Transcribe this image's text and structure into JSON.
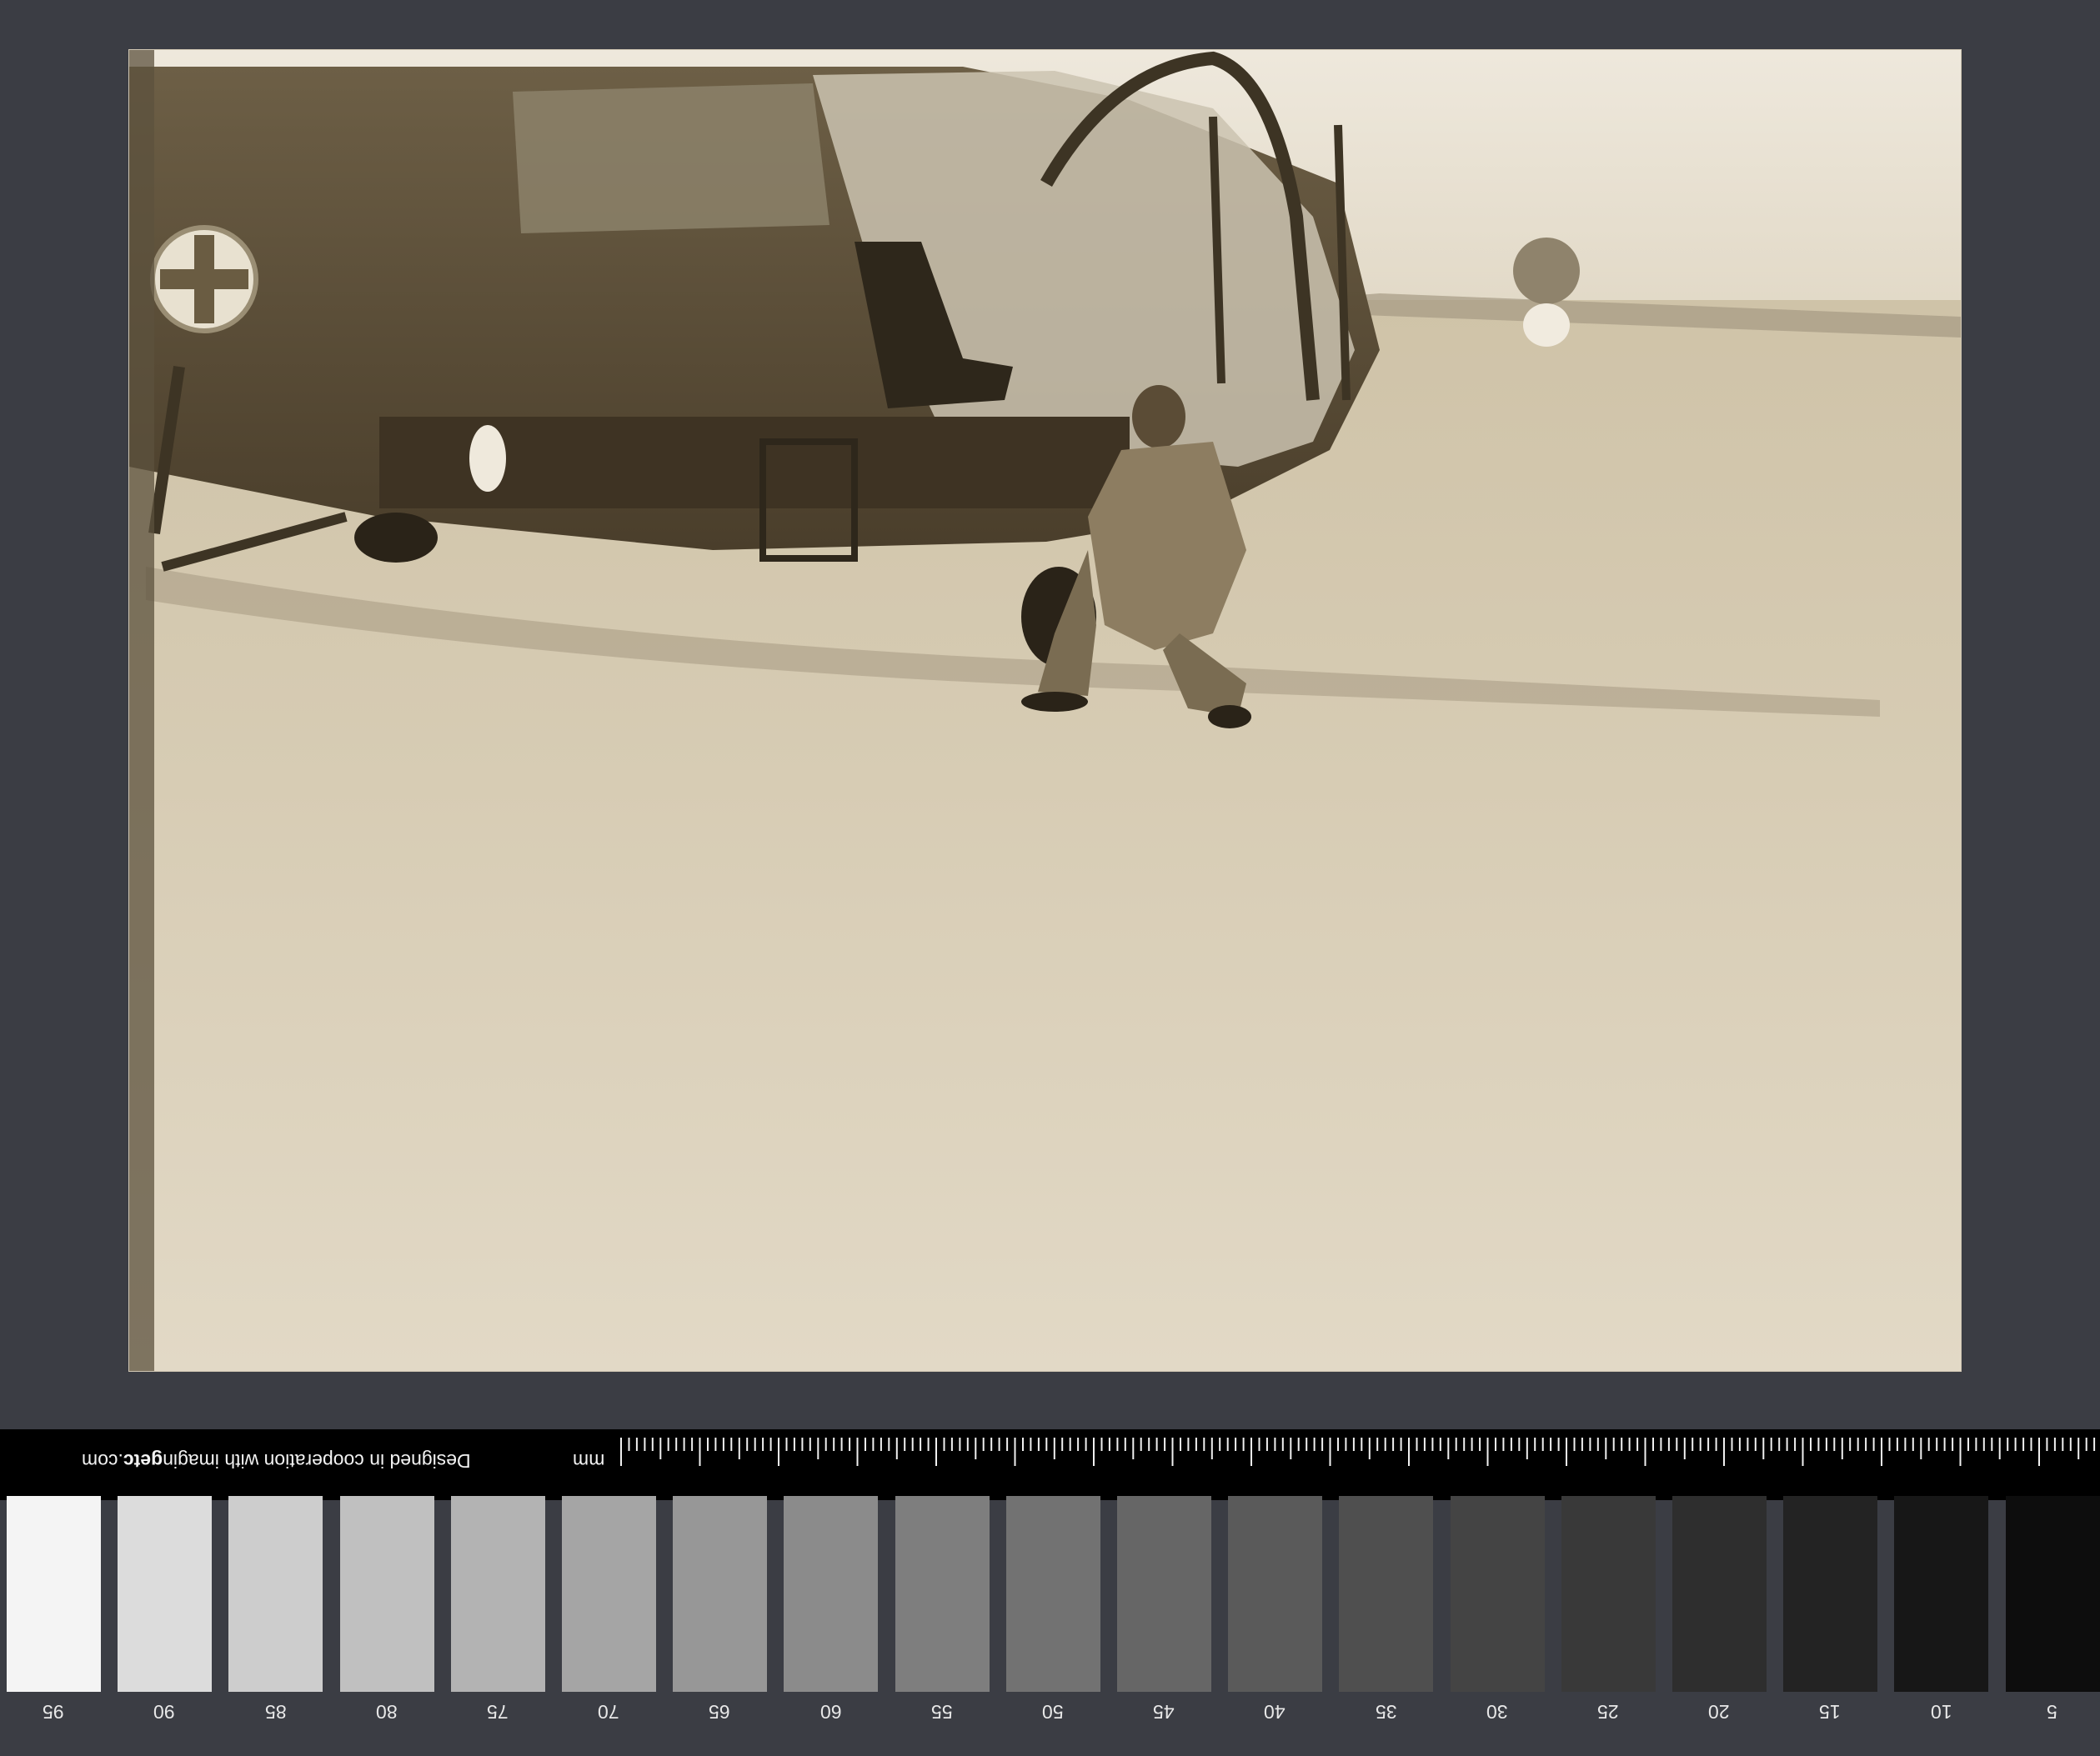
{
  "photo": {
    "subject_icon": "helicopter-photo",
    "roundel_icon": "cross-roundel-icon"
  },
  "scale": {
    "credit_prefix": "Designed in cooperation with imagin",
    "credit_bold": "getc",
    "credit_suffix": ".com",
    "unit": "mm"
  },
  "gray_scale": {
    "labels": [
      "95",
      "90",
      "85",
      "80",
      "75",
      "70",
      "65",
      "60",
      "55",
      "50",
      "45",
      "40",
      "35",
      "30",
      "25",
      "20",
      "15",
      "10",
      "5"
    ],
    "colors": [
      "#f4f4f4",
      "#dcdcdc",
      "#cdcdcd",
      "#c0c0c0",
      "#b3b3b3",
      "#a5a5a5",
      "#979797",
      "#8b8b8b",
      "#7e7e7e",
      "#727272",
      "#666666",
      "#5a5a5a",
      "#4f4f4f",
      "#444444",
      "#393939",
      "#2e2e2e",
      "#232323",
      "#171717",
      "#0d0d0d"
    ]
  }
}
